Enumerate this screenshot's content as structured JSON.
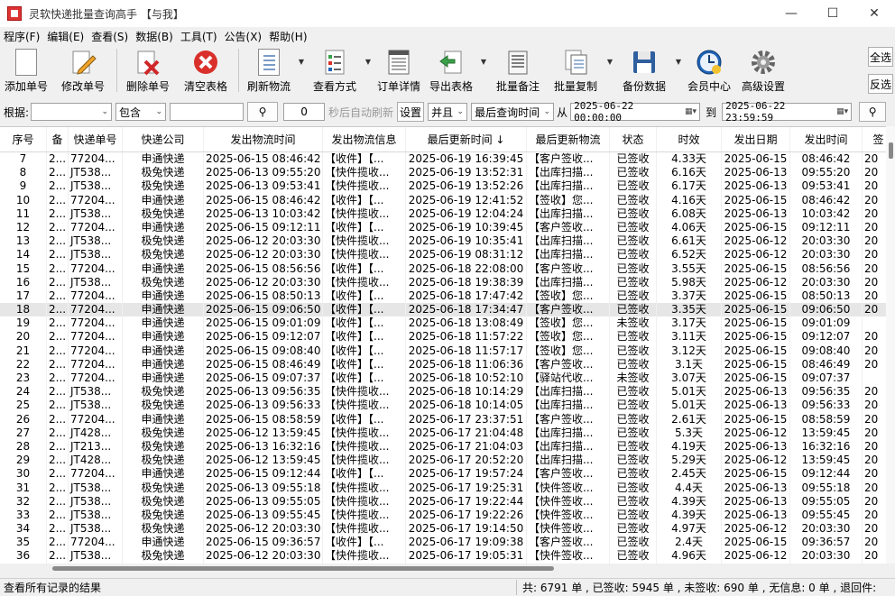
{
  "window": {
    "title": "灵软快递批量查询高手 【与我】",
    "min": "—",
    "max": "☐",
    "close": "✕"
  },
  "menu": [
    "程序(F)",
    "编辑(E)",
    "查看(S)",
    "数据(B)",
    "工具(T)",
    "公告(X)",
    "帮助(H)"
  ],
  "toolbar": {
    "add": "添加单号",
    "edit": "修改单号",
    "delete": "删除单号",
    "clear": "清空表格",
    "refresh": "刷新物流",
    "view_mode": "查看方式",
    "detail": "订单详情",
    "export": "导出表格",
    "batch_note": "批量备注",
    "batch_copy": "批量复制",
    "backup": "备份数据",
    "member": "会员中心",
    "advanced": "高级设置",
    "select_all": "全选",
    "invert": "反选"
  },
  "filter": {
    "by_label": "根据:",
    "by_value": "",
    "mode_value": "包含",
    "keyword": "",
    "seconds": "0",
    "auto_refresh_label": "秒后自动刷新",
    "settings": "设置",
    "logic": "并且",
    "time_field": "最后查询时间",
    "from_label": "从",
    "from_value": "2025-06-22 00:00:00",
    "to_label": "到",
    "to_value": "2025-06-22 23:59:59"
  },
  "table": {
    "headers": [
      "序号",
      "备",
      "快递单号",
      "快递公司",
      "发出物流时间",
      "发出物流信息",
      "最后更新时间 ↓",
      "最后更新物流",
      "状态",
      "时效",
      "发出日期",
      "发出时间",
      "签"
    ],
    "rows": [
      [
        "7",
        "2...",
        "77204...",
        "申通快递",
        "2025-06-15 08:46:42",
        "【收件】【...",
        "2025-06-19 16:39:45",
        "【客户签收...",
        "已签收",
        "4.33天",
        "2025-06-15",
        "08:46:42",
        "20"
      ],
      [
        "8",
        "2...",
        "JT538...",
        "极兔快递",
        "2025-06-13 09:55:20",
        "【快件揽收...",
        "2025-06-19 13:52:31",
        "【出库扫描...",
        "已签收",
        "6.16天",
        "2025-06-13",
        "09:55:20",
        "20"
      ],
      [
        "9",
        "2...",
        "JT538...",
        "极兔快递",
        "2025-06-13 09:53:41",
        "【快件揽收...",
        "2025-06-19 13:52:26",
        "【出库扫描...",
        "已签收",
        "6.17天",
        "2025-06-13",
        "09:53:41",
        "20"
      ],
      [
        "10",
        "2...",
        "77204...",
        "申通快递",
        "2025-06-15 08:46:42",
        "【收件】【...",
        "2025-06-19 12:41:52",
        "【签收】您...",
        "已签收",
        "4.16天",
        "2025-06-15",
        "08:46:42",
        "20"
      ],
      [
        "11",
        "2...",
        "JT538...",
        "极兔快递",
        "2025-06-13 10:03:42",
        "【快件揽收...",
        "2025-06-19 12:04:24",
        "【出库扫描...",
        "已签收",
        "6.08天",
        "2025-06-13",
        "10:03:42",
        "20"
      ],
      [
        "12",
        "2...",
        "77204...",
        "申通快递",
        "2025-06-15 09:12:11",
        "【收件】【...",
        "2025-06-19 10:39:45",
        "【客户签收...",
        "已签收",
        "4.06天",
        "2025-06-15",
        "09:12:11",
        "20"
      ],
      [
        "13",
        "2...",
        "JT538...",
        "极兔快递",
        "2025-06-12 20:03:30",
        "【快件揽收...",
        "2025-06-19 10:35:41",
        "【出库扫描...",
        "已签收",
        "6.61天",
        "2025-06-12",
        "20:03:30",
        "20"
      ],
      [
        "14",
        "2...",
        "JT538...",
        "极兔快递",
        "2025-06-12 20:03:30",
        "【快件揽收...",
        "2025-06-19 08:31:12",
        "【出库扫描...",
        "已签收",
        "6.52天",
        "2025-06-12",
        "20:03:30",
        "20"
      ],
      [
        "15",
        "2...",
        "77204...",
        "申通快递",
        "2025-06-15 08:56:56",
        "【收件】【...",
        "2025-06-18 22:08:00",
        "【客户签收...",
        "已签收",
        "3.55天",
        "2025-06-15",
        "08:56:56",
        "20"
      ],
      [
        "16",
        "2...",
        "JT538...",
        "极兔快递",
        "2025-06-12 20:03:30",
        "【快件揽收...",
        "2025-06-18 19:38:39",
        "【出库扫描...",
        "已签收",
        "5.98天",
        "2025-06-12",
        "20:03:30",
        "20"
      ],
      [
        "17",
        "2...",
        "77204...",
        "申通快递",
        "2025-06-15 08:50:13",
        "【收件】【...",
        "2025-06-18 17:47:42",
        "【签收】您...",
        "已签收",
        "3.37天",
        "2025-06-15",
        "08:50:13",
        "20"
      ],
      [
        "18",
        "2...",
        "77204...",
        "申通快递",
        "2025-06-15 09:06:50",
        "【收件】【...",
        "2025-06-18 17:34:47",
        "【客户签收...",
        "已签收",
        "3.35天",
        "2025-06-15",
        "09:06:50",
        "20"
      ],
      [
        "19",
        "2...",
        "77204...",
        "申通快递",
        "2025-06-15 09:01:09",
        "【收件】【...",
        "2025-06-18 13:08:49",
        "【签收】您...",
        "未签收",
        "3.17天",
        "2025-06-15",
        "09:01:09",
        ""
      ],
      [
        "20",
        "2...",
        "77204...",
        "申通快递",
        "2025-06-15 09:12:07",
        "【收件】【...",
        "2025-06-18 11:57:22",
        "【签收】您...",
        "已签收",
        "3.11天",
        "2025-06-15",
        "09:12:07",
        "20"
      ],
      [
        "21",
        "2...",
        "77204...",
        "申通快递",
        "2025-06-15 09:08:40",
        "【收件】【...",
        "2025-06-18 11:57:17",
        "【签收】您...",
        "已签收",
        "3.12天",
        "2025-06-15",
        "09:08:40",
        "20"
      ],
      [
        "22",
        "2...",
        "77204...",
        "申通快递",
        "2025-06-15 08:46:49",
        "【收件】【...",
        "2025-06-18 11:06:36",
        "【客户签收...",
        "已签收",
        "3.1天",
        "2025-06-15",
        "08:46:49",
        "20"
      ],
      [
        "23",
        "2...",
        "77204...",
        "申通快递",
        "2025-06-15 09:07:37",
        "【收件】【...",
        "2025-06-18 10:52:10",
        "【驿站代收...",
        "未签收",
        "3.07天",
        "2025-06-15",
        "09:07:37",
        ""
      ],
      [
        "24",
        "2...",
        "JT538...",
        "极兔快递",
        "2025-06-13 09:56:35",
        "【快件揽收...",
        "2025-06-18 10:14:29",
        "【出库扫描...",
        "已签收",
        "5.01天",
        "2025-06-13",
        "09:56:35",
        "20"
      ],
      [
        "25",
        "2...",
        "JT538...",
        "极兔快递",
        "2025-06-13 09:56:33",
        "【快件揽收...",
        "2025-06-18 10:14:05",
        "【出库扫描...",
        "已签收",
        "5.01天",
        "2025-06-13",
        "09:56:33",
        "20"
      ],
      [
        "26",
        "2...",
        "77204...",
        "申通快递",
        "2025-06-15 08:58:59",
        "【收件】【...",
        "2025-06-17 23:37:51",
        "【客户签收...",
        "已签收",
        "2.61天",
        "2025-06-15",
        "08:58:59",
        "20"
      ],
      [
        "27",
        "2...",
        "JT428...",
        "极兔快递",
        "2025-06-12 13:59:45",
        "【快件揽收...",
        "2025-06-17 21:04:48",
        "【出库扫描...",
        "已签收",
        "5.3天",
        "2025-06-12",
        "13:59:45",
        "20"
      ],
      [
        "28",
        "2...",
        "JT213...",
        "极兔快递",
        "2025-06-13 16:32:16",
        "【快件揽收...",
        "2025-06-17 21:04:03",
        "【出库扫描...",
        "已签收",
        "4.19天",
        "2025-06-13",
        "16:32:16",
        "20"
      ],
      [
        "29",
        "2...",
        "JT428...",
        "极兔快递",
        "2025-06-12 13:59:45",
        "【快件揽收...",
        "2025-06-17 20:52:20",
        "【出库扫描...",
        "已签收",
        "5.29天",
        "2025-06-12",
        "13:59:45",
        "20"
      ],
      [
        "30",
        "2...",
        "77204...",
        "申通快递",
        "2025-06-15 09:12:44",
        "【收件】【...",
        "2025-06-17 19:57:24",
        "【客户签收...",
        "已签收",
        "2.45天",
        "2025-06-15",
        "09:12:44",
        "20"
      ],
      [
        "31",
        "2...",
        "JT538...",
        "极兔快递",
        "2025-06-13 09:55:18",
        "【快件揽收...",
        "2025-06-17 19:25:31",
        "【快件签收...",
        "已签收",
        "4.4天",
        "2025-06-13",
        "09:55:18",
        "20"
      ],
      [
        "32",
        "2...",
        "JT538...",
        "极兔快递",
        "2025-06-13 09:55:05",
        "【快件揽收...",
        "2025-06-17 19:22:44",
        "【快件签收...",
        "已签收",
        "4.39天",
        "2025-06-13",
        "09:55:05",
        "20"
      ],
      [
        "33",
        "2...",
        "JT538...",
        "极兔快递",
        "2025-06-13 09:55:45",
        "【快件揽收...",
        "2025-06-17 19:22:26",
        "【快件签收...",
        "已签收",
        "4.39天",
        "2025-06-13",
        "09:55:45",
        "20"
      ],
      [
        "34",
        "2...",
        "JT538...",
        "极兔快递",
        "2025-06-12 20:03:30",
        "【快件揽收...",
        "2025-06-17 19:14:50",
        "【快件签收...",
        "已签收",
        "4.97天",
        "2025-06-12",
        "20:03:30",
        "20"
      ],
      [
        "35",
        "2...",
        "77204...",
        "申通快递",
        "2025-06-15 09:36:57",
        "【收件】【...",
        "2025-06-17 19:09:38",
        "【客户签收...",
        "已签收",
        "2.4天",
        "2025-06-15",
        "09:36:57",
        "20"
      ],
      [
        "36",
        "2...",
        "JT538...",
        "极兔快递",
        "2025-06-12 20:03:30",
        "【快件揽收...",
        "2025-06-17 19:05:31",
        "【快件签收...",
        "已签收",
        "4.96天",
        "2025-06-12",
        "20:03:30",
        "20"
      ]
    ],
    "selected_row": 11
  },
  "status": {
    "left": "查看所有记录的结果",
    "right": "共: 6791 单 , 已签收: 5945 单 , 未签收: 690 单 , 无信息: 0 单 , 退回件:"
  },
  "colors": {
    "accent": "#d33",
    "doc_line": "#7a9cc6",
    "clock_blue": "#1e63b5",
    "clear_red": "#d9302b",
    "export_green": "#3aa04a"
  },
  "icons": [
    "file-add-icon",
    "pencil-icon",
    "delete-x-icon",
    "clear-icon",
    "refresh-doc-icon",
    "checklist-icon",
    "detail-icon",
    "export-icon",
    "note-icon",
    "copy-icon",
    "save-icon",
    "clock-icon",
    "gear-icon",
    "search-icon",
    "calendar-icon"
  ]
}
